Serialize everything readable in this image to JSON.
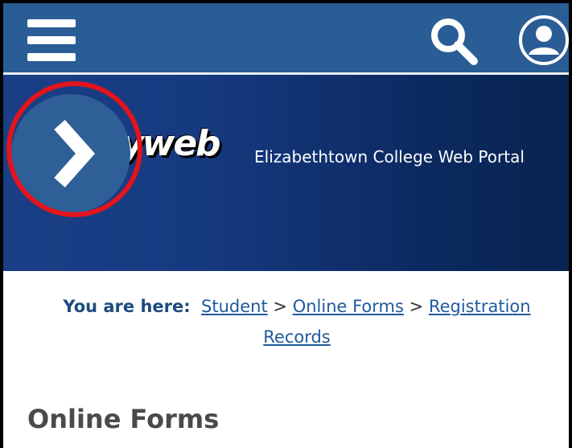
{
  "header": {
    "menu_icon": "hamburger-menu-icon",
    "search_icon": "search-icon",
    "account_icon": "user-account-icon"
  },
  "banner": {
    "logo_text": "yweb",
    "portal_title": "Elizabethtown College Web Portal",
    "expand_icon": "chevron-right-icon"
  },
  "breadcrumb": {
    "label": "You are here:",
    "items": [
      "Student",
      "Online Forms",
      "Registration Records"
    ],
    "separator": ">"
  },
  "page": {
    "heading": "Online Forms"
  },
  "colors": {
    "topbar": "#2a5d95",
    "banner_dark": "#0d2b64",
    "highlight": "#e3141b",
    "link": "#1f5a9c"
  }
}
